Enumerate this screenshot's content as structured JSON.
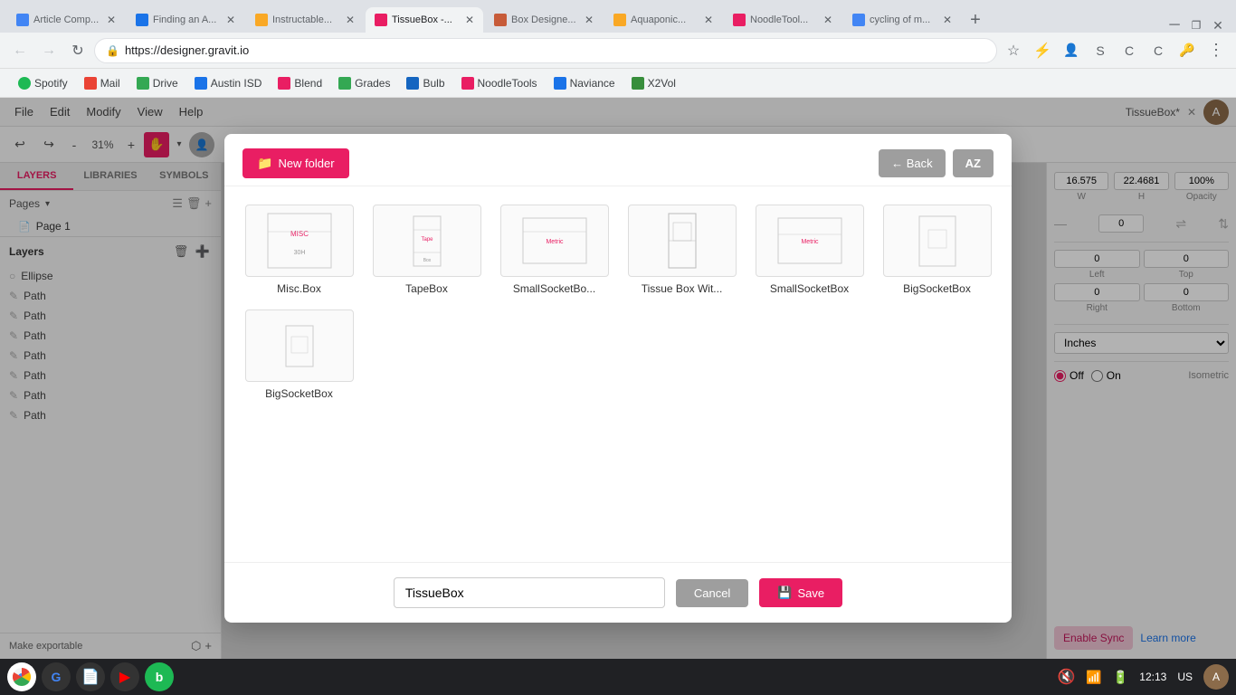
{
  "browser": {
    "tabs": [
      {
        "id": "tab1",
        "title": "Article Comp...",
        "favicon_color": "#4285f4",
        "active": false
      },
      {
        "id": "tab2",
        "title": "Finding an A...",
        "favicon_color": "#1a73e8",
        "active": false
      },
      {
        "id": "tab3",
        "title": "Instructable...",
        "favicon_color": "#f9a825",
        "active": false
      },
      {
        "id": "tab4",
        "title": "TissueBox -...",
        "favicon_color": "#e91e63",
        "active": true
      },
      {
        "id": "tab5",
        "title": "Box Designe...",
        "favicon_color": "#c75b39",
        "active": false
      },
      {
        "id": "tab6",
        "title": "Aquaponic...",
        "favicon_color": "#f9a825",
        "active": false
      },
      {
        "id": "tab7",
        "title": "NoodleTool...",
        "favicon_color": "#e91e63",
        "active": false
      },
      {
        "id": "tab8",
        "title": "cycling of m...",
        "favicon_color": "#4285f4",
        "active": false
      }
    ],
    "address": "https://designer.gravit.io",
    "secure_label": "Secure"
  },
  "bookmarks": [
    {
      "label": "Spotify",
      "color": "#1db954"
    },
    {
      "label": "Mail",
      "color": "#ea4335"
    },
    {
      "label": "Drive",
      "color": "#34a853"
    },
    {
      "label": "Austin ISD",
      "color": "#1a73e8"
    },
    {
      "label": "Blend",
      "color": "#e91e63"
    },
    {
      "label": "Grades",
      "color": "#34a853"
    },
    {
      "label": "Bulb",
      "color": "#1565c0"
    },
    {
      "label": "NoodleTools",
      "color": "#e91e63"
    },
    {
      "label": "Naviance",
      "color": "#1a73e8"
    },
    {
      "label": "X2Vol",
      "color": "#388e3c"
    }
  ],
  "app": {
    "header_items": [
      "File",
      "Edit",
      "Modify",
      "View",
      "Help"
    ],
    "current_tab": "TissueBox*",
    "toolbar": {
      "zoom": "31%"
    }
  },
  "left_panel": {
    "tabs": [
      "LAYERS",
      "LIBRARIES",
      "SYMBOLS"
    ],
    "active_tab": "LAYERS",
    "pages": [
      {
        "label": "Pages",
        "arrow": "▾"
      }
    ],
    "page_items": [
      {
        "label": "Page 1"
      }
    ],
    "layers": {
      "title": "Layers",
      "items": [
        {
          "label": "Ellipse",
          "icon": "○"
        },
        {
          "label": "Path",
          "icon": "✎"
        },
        {
          "label": "Path",
          "icon": "✎"
        },
        {
          "label": "Path",
          "icon": "✎"
        },
        {
          "label": "Path",
          "icon": "✎"
        },
        {
          "label": "Path",
          "icon": "✎"
        },
        {
          "label": "Path",
          "icon": "✎"
        },
        {
          "label": "Path",
          "icon": "✎"
        }
      ]
    },
    "make_exportable": "Make exportable"
  },
  "right_panel": {
    "width_label": "W",
    "height_label": "H",
    "opacity_label": "Opacity",
    "width_value": "16.575",
    "height_value": "22.4681",
    "opacity_value": "100%",
    "rotation_value": "0",
    "corner_values": {
      "left": "0",
      "top": "0",
      "right": "0",
      "bottom": "0"
    },
    "position_labels": [
      "Left",
      "Top",
      "Right",
      "Bottom"
    ],
    "units_value": "Inches",
    "grid_label": "Isometric",
    "grid_off": "Off",
    "grid_on": "On",
    "enable_sync": "Enable Sync",
    "learn_more": "Learn more"
  },
  "modal": {
    "new_folder_label": "New folder",
    "back_label": "← Back",
    "az_label": "AZ",
    "files": [
      {
        "name": "Misc.Box",
        "has_content": true
      },
      {
        "name": "TapeBox",
        "has_content": true
      },
      {
        "name": "SmallSocketBo...",
        "has_content": true
      },
      {
        "name": "Tissue Box Wit...",
        "has_content": true
      },
      {
        "name": "SmallSocketBox",
        "has_content": true
      },
      {
        "name": "BigSocketBox",
        "has_content": false
      },
      {
        "name": "BigSocketBox",
        "has_content": false
      }
    ],
    "filename": "TissueBox",
    "cancel_label": "Cancel",
    "save_label": "Save",
    "save_icon": "💾"
  },
  "taskbar": {
    "time": "12:13",
    "locale": "US"
  }
}
